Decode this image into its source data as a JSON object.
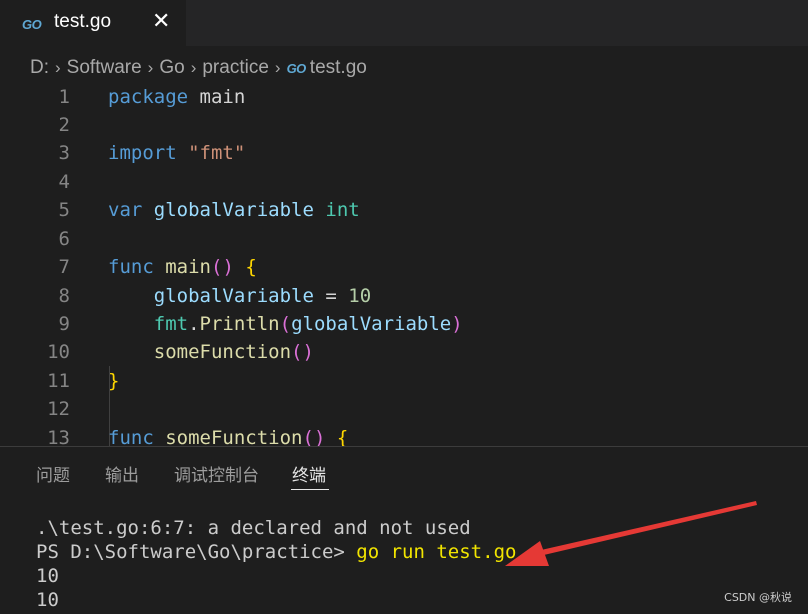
{
  "tab": {
    "icon": "go-file-icon",
    "icon_text": "GO",
    "name": "test.go",
    "close": "✕"
  },
  "breadcrumb": {
    "items": [
      "D:",
      "Software",
      "Go",
      "practice"
    ],
    "file_icon_text": "GO",
    "file": "test.go"
  },
  "editor": {
    "line_numbers": [
      "1",
      "2",
      "3",
      "4",
      "5",
      "6",
      "7",
      "8",
      "9",
      "10",
      "11",
      "12",
      "13"
    ],
    "code_tokens": {
      "l1": [
        "package",
        "main"
      ],
      "l3": [
        "import",
        "\"fmt\""
      ],
      "l5": [
        "var",
        "globalVariable",
        "int"
      ],
      "l7": [
        "func",
        "main",
        "(",
        ")",
        "{"
      ],
      "l8": [
        "globalVariable",
        "=",
        "10"
      ],
      "l9": [
        "fmt",
        ".",
        "Println",
        "(",
        "globalVariable",
        ")"
      ],
      "l10": [
        "someFunction",
        "(",
        ")"
      ],
      "l11": [
        "}"
      ],
      "l13": [
        "func",
        "someFunction",
        "(",
        ")",
        "{"
      ]
    }
  },
  "panel": {
    "tabs": [
      "问题",
      "输出",
      "调试控制台",
      "终端"
    ],
    "active_tab": "终端"
  },
  "terminal": {
    "lines": [
      ".\\test.go:6:7: a declared and not used",
      "PS D:\\Software\\Go\\practice> ",
      "10",
      "10"
    ],
    "command": "go run test.go"
  },
  "watermark": "CSDN @秋说",
  "annotation": {
    "icon": "red-arrow-icon",
    "color": "#e53935"
  }
}
